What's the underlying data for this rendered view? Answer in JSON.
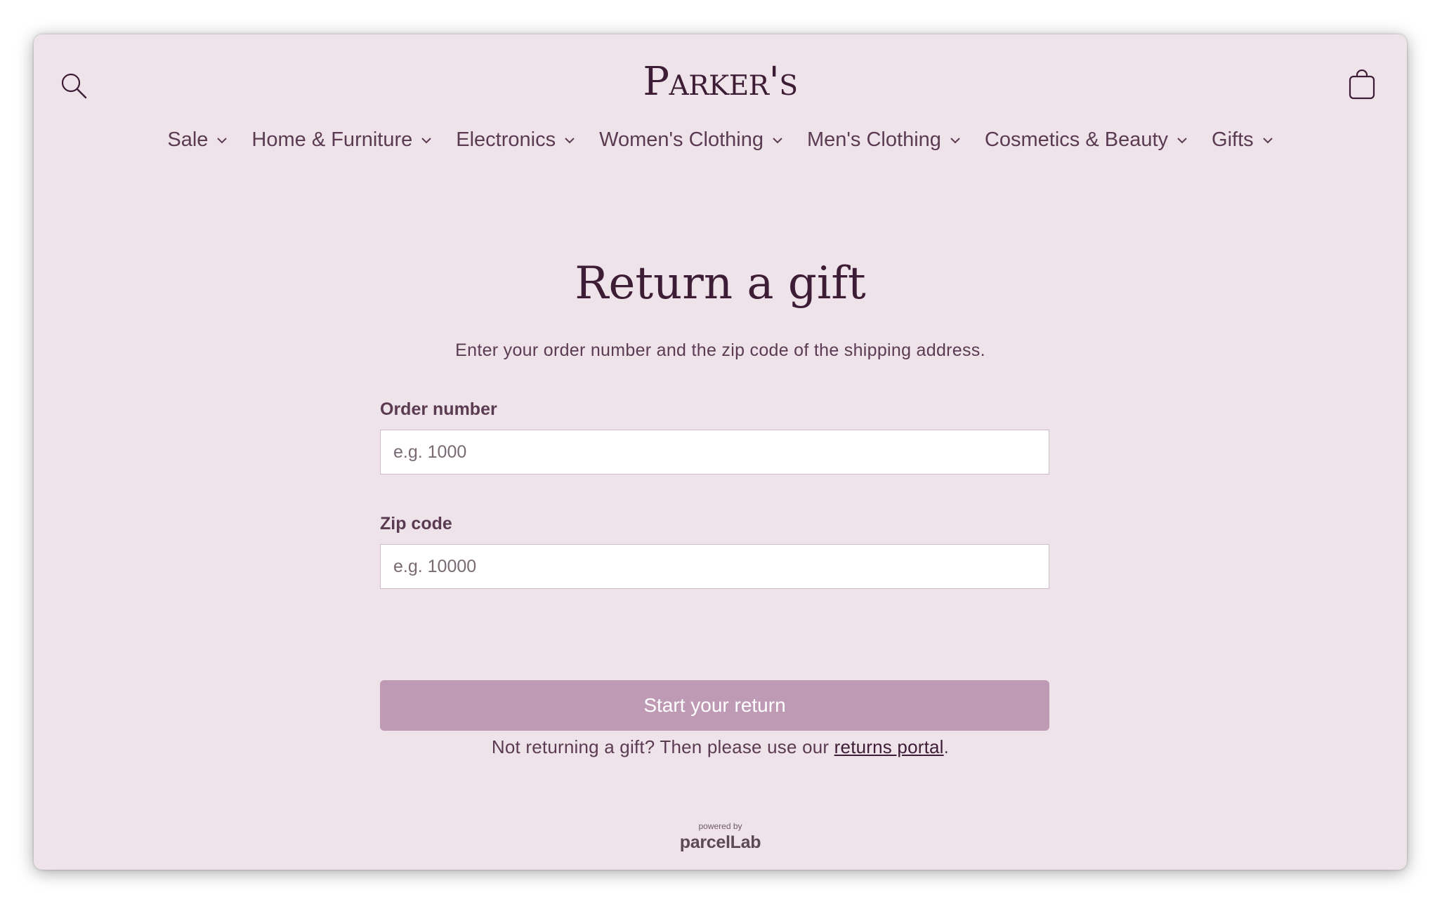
{
  "header": {
    "logo": "Parker's",
    "search_icon": "search-icon",
    "cart_icon": "cart-bag-icon"
  },
  "nav": {
    "items": [
      {
        "label": "Sale"
      },
      {
        "label": "Home & Furniture"
      },
      {
        "label": "Electronics"
      },
      {
        "label": "Women's Clothing"
      },
      {
        "label": "Men's Clothing"
      },
      {
        "label": "Cosmetics & Beauty"
      },
      {
        "label": "Gifts"
      }
    ]
  },
  "main": {
    "title": "Return a gift",
    "subtitle": "Enter your order number and the zip code of the shipping address.",
    "order_number": {
      "label": "Order number",
      "placeholder": "e.g. 1000",
      "value": ""
    },
    "zip_code": {
      "label": "Zip code",
      "placeholder": "e.g. 10000",
      "value": ""
    },
    "submit_label": "Start your return",
    "note_prefix": "Not returning a gift? Then please use our ",
    "note_link": "returns portal",
    "note_suffix": "."
  },
  "footer": {
    "powered_by": "powered by",
    "brand": "parcelLab"
  },
  "colors": {
    "background": "#efe3ea",
    "text_dark": "#3d1c35",
    "text_muted": "#5a3b52",
    "button": "#bf9ab4"
  }
}
